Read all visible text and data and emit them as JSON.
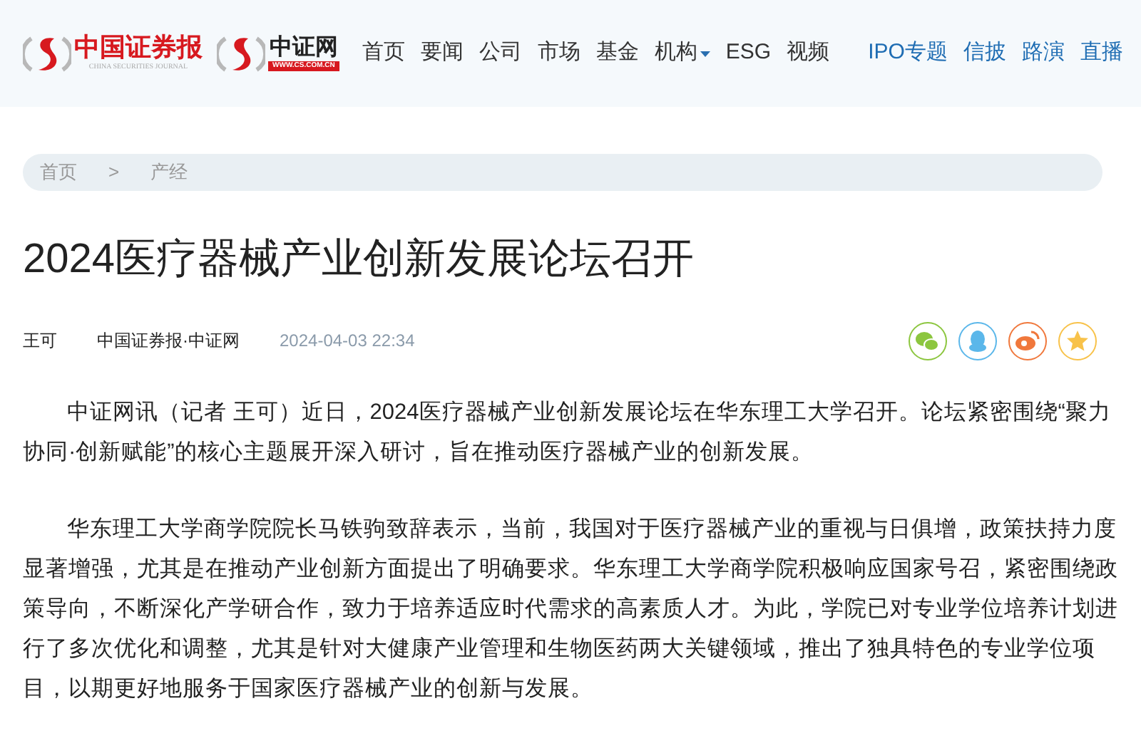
{
  "header": {
    "logo_primary": {
      "title": "中国证券报",
      "subtitle": "CHINA SECURITIES JOURNAL"
    },
    "logo_secondary": {
      "title": "中证网",
      "url": "WWW.CS.COM.CN"
    },
    "nav": [
      {
        "label": "首页",
        "kind": "plain"
      },
      {
        "label": "要闻",
        "kind": "plain"
      },
      {
        "label": "公司",
        "kind": "plain"
      },
      {
        "label": "市场",
        "kind": "plain"
      },
      {
        "label": "基金",
        "kind": "plain"
      },
      {
        "label": "机构",
        "kind": "dropdown"
      },
      {
        "label": "ESG",
        "kind": "plain"
      },
      {
        "label": "视频",
        "kind": "plain"
      }
    ],
    "special_links": [
      "IPO专题",
      "信披",
      "路演",
      "直播"
    ]
  },
  "breadcrumb": [
    "首页",
    "产经"
  ],
  "breadcrumb_separator": ">",
  "article": {
    "title": "2024医疗器械产业创新发展论坛召开",
    "author": "王可",
    "source": "中国证券报·中证网",
    "time": "2024-04-03 22:34",
    "share": [
      {
        "kind": "wechat",
        "color": "#8cc63f"
      },
      {
        "kind": "qq",
        "color": "#5bb7ea"
      },
      {
        "kind": "weibo",
        "color": "#f0783c"
      },
      {
        "kind": "star",
        "color": "#f8c24a"
      }
    ],
    "paragraphs": [
      "中证网讯（记者 王可）近日，2024医疗器械产业创新发展论坛在华东理工大学召开。论坛紧密围绕“聚力协同·创新赋能”的核心主题展开深入研讨，旨在推动医疗器械产业的创新发展。",
      "华东理工大学商学院院长马铁驹致辞表示，当前，我国对于医疗器械产业的重视与日俱增，政策扶持力度显著增强，尤其是在推动产业创新方面提出了明确要求。华东理工大学商学院积极响应国家号召，紧密围绕政策导向，不断深化产学研合作，致力于培养适应时代需求的高素质人才。为此，学院已对专业学位培养计划进行了多次优化和调整，尤其是针对大健康产业管理和生物医药两大关键领域，推出了独具特色的专业学位项目，以期更好地服务于国家医疗器械产业的创新与发展。"
    ]
  }
}
